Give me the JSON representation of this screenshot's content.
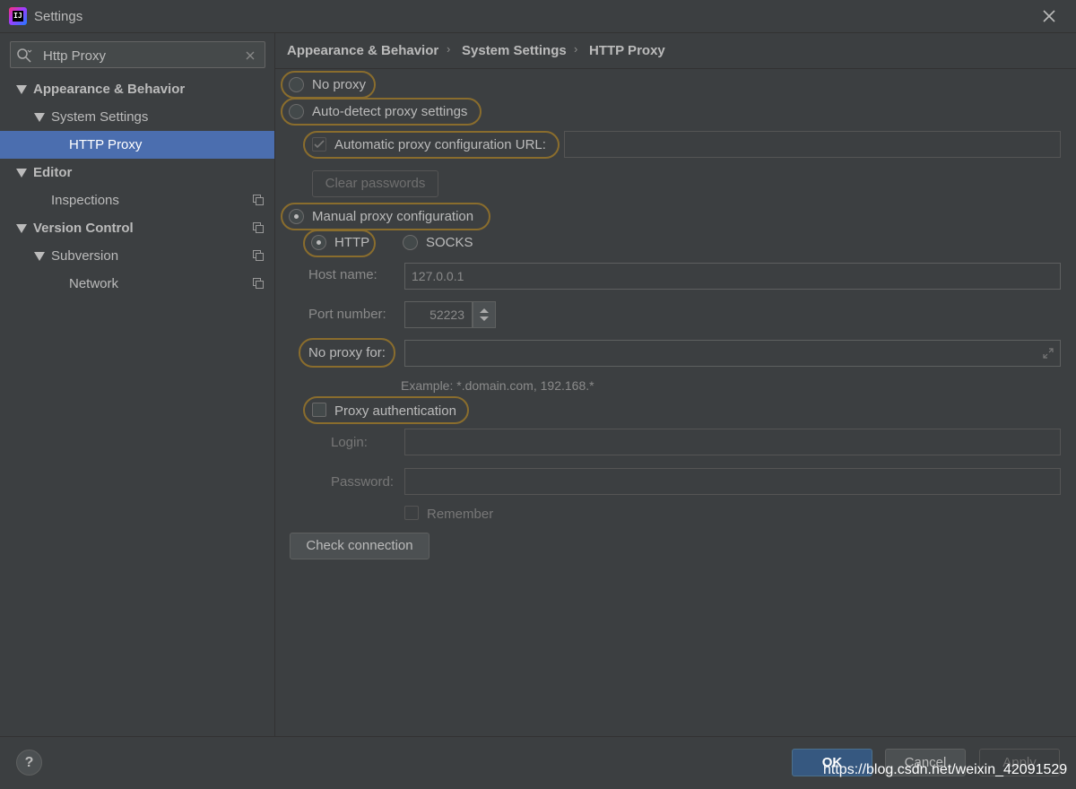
{
  "window": {
    "title": "Settings"
  },
  "search": {
    "value": "Http Proxy"
  },
  "sidebar": {
    "items": [
      {
        "label": "Appearance & Behavior"
      },
      {
        "label": "System Settings"
      },
      {
        "label": "HTTP Proxy"
      },
      {
        "label": "Editor"
      },
      {
        "label": "Inspections"
      },
      {
        "label": "Version Control"
      },
      {
        "label": "Subversion"
      },
      {
        "label": "Network"
      }
    ]
  },
  "breadcrumb": {
    "items": [
      "Appearance & Behavior",
      "System Settings",
      "HTTP Proxy"
    ],
    "separator": "›"
  },
  "proxy": {
    "no_proxy": "No proxy",
    "auto_detect": "Auto-detect proxy settings",
    "auto_config_url": "Automatic proxy configuration URL:",
    "clear_passwords": "Clear passwords",
    "manual": "Manual proxy configuration",
    "http": "HTTP",
    "socks": "SOCKS",
    "host_label": "Host name:",
    "host_value": "127.0.0.1",
    "port_label": "Port number:",
    "port_value": "52223",
    "no_proxy_for_label": "No proxy for:",
    "example": "Example: *.domain.com, 192.168.*",
    "proxy_auth": "Proxy authentication",
    "login_label": "Login:",
    "password_label": "Password:",
    "remember": "Remember",
    "check_connection": "Check connection"
  },
  "footer": {
    "help": "?",
    "ok": "OK",
    "cancel": "Cancel",
    "apply": "Apply"
  },
  "watermark": "https://blog.csdn.net/weixin_42091529",
  "colors": {
    "selection": "#4b6eaf",
    "highlight_ring": "#8a6d2d",
    "background": "#3c3f41"
  }
}
